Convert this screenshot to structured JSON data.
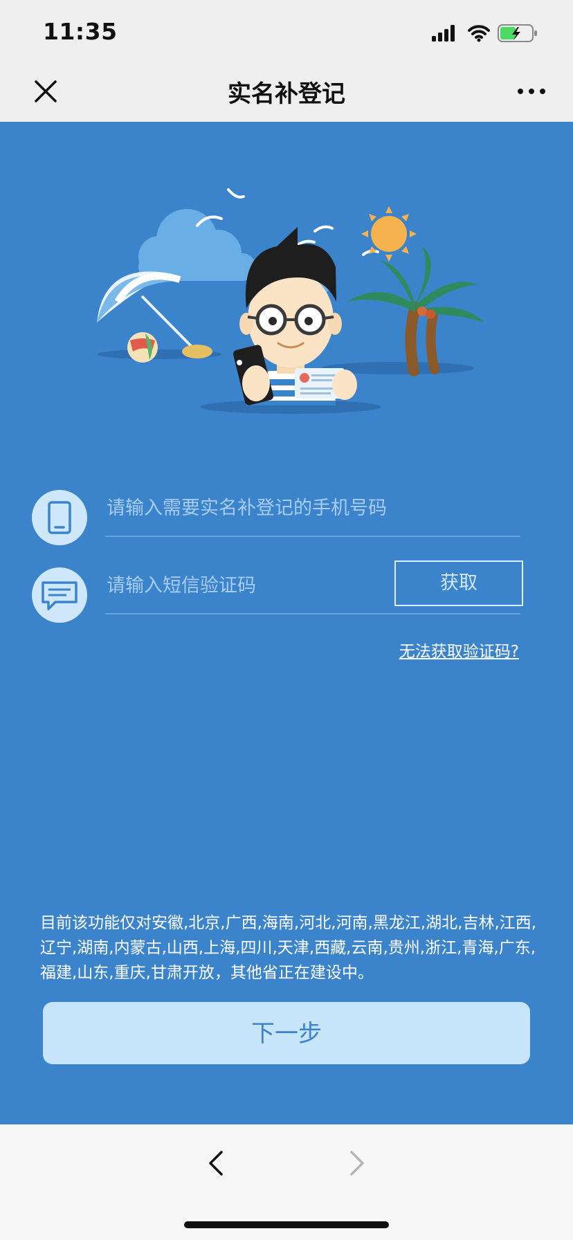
{
  "status_bar": {
    "time": "11:35"
  },
  "nav": {
    "title": "实名补登记"
  },
  "form": {
    "phone_placeholder": "请输入需要实名补登记的手机号码",
    "sms_placeholder": "请输入短信验证码",
    "get_code_label": "获取",
    "help_link": "无法获取验证码?"
  },
  "notice": "目前该功能仅对安徽,北京,广西,海南,河北,河南,黑龙江,湖北,吉林,江西,辽宁,湖南,内蒙古,山西,上海,四川,天津,西藏,云南,贵州,浙江,青海,广东,福建,山东,重庆,甘肃开放，其他省正在建设中。",
  "next_button": "下一步",
  "colors": {
    "background_blue": "#3b83cb",
    "button_light_blue": "#c6e4fa",
    "icon_circle": "#cfe7fa",
    "bar_gray": "#efefef"
  }
}
